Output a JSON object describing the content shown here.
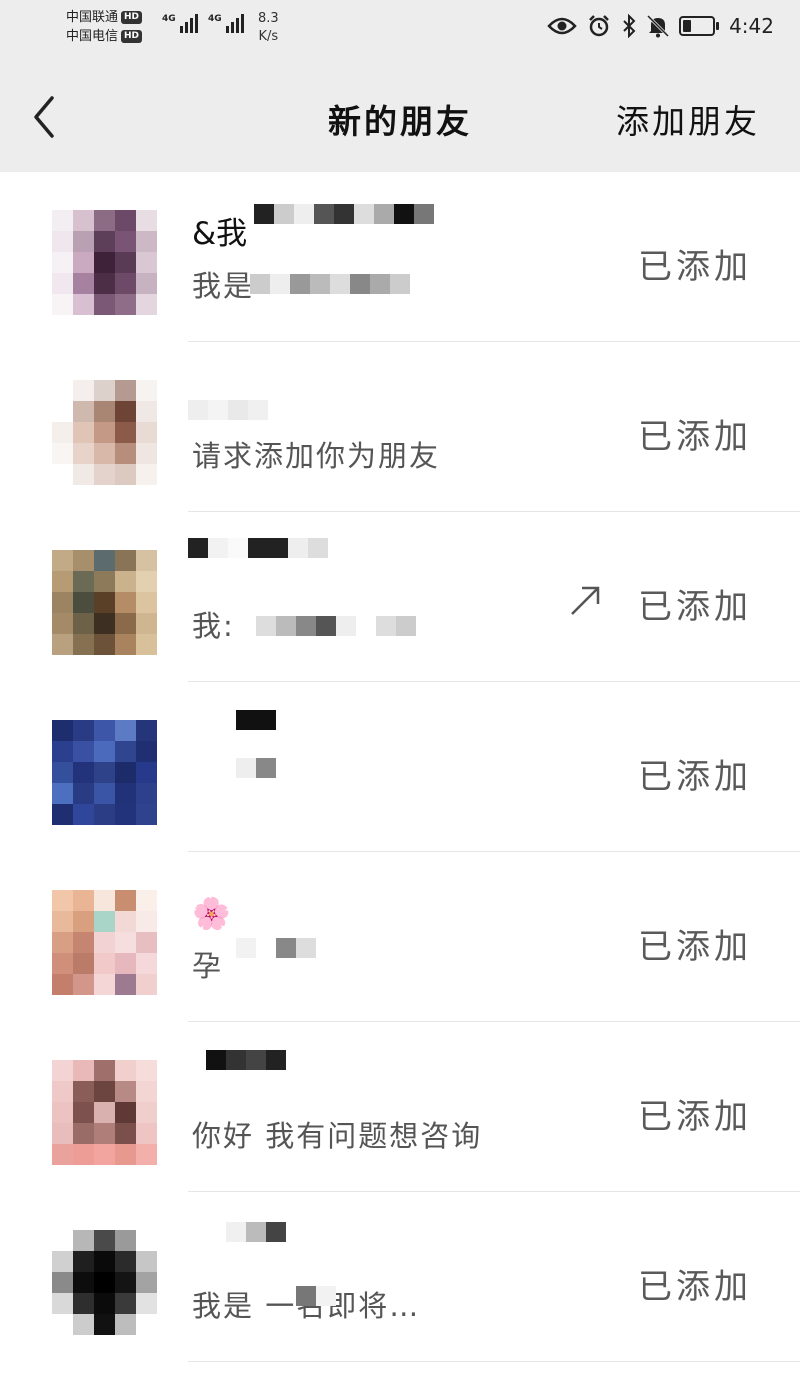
{
  "statusbar": {
    "carrier1": "中国联通",
    "carrier2": "中国电信",
    "hd": "HD",
    "network": "4G",
    "speed_value": "8.3",
    "speed_unit": "K/s",
    "battery_level": 0.3,
    "time": "4:42",
    "icons": [
      "eye-icon",
      "alarm-icon",
      "bluetooth-icon",
      "mute-icon",
      "battery-icon"
    ]
  },
  "navbar": {
    "back_icon": "chevron-left-icon",
    "title": "新的朋友",
    "action": "添加朋友"
  },
  "friends": [
    {
      "name": "&我",
      "msg": "我是",
      "status": "已添加",
      "avatar_colors": [
        "#f2eef2",
        "#d7c1cf",
        "#8c6b84",
        "#6c4a67",
        "#e9dde4",
        "#efe6ee",
        "#b9a0b3",
        "#5e3f5a",
        "#7a5474",
        "#cdb9c6",
        "#f6f1f4",
        "#c9aac0",
        "#3e2239",
        "#5a3b55",
        "#d9c7d3",
        "#f1e8ef",
        "#a681a0",
        "#4c2e47",
        "#6d4a67",
        "#c7b2c1",
        "#f8f4f6",
        "#d8bfd1",
        "#7b5876",
        "#8f6d88",
        "#e4d6df"
      ]
    },
    {
      "name": "",
      "msg": "请求添加你为朋友",
      "status": "已添加",
      "avatar_colors": [
        "#ffffff",
        "#f4eeec",
        "#ddd1cc",
        "#b49a90",
        "#f7f3f1",
        "#ffffff",
        "#cfb8ae",
        "#a88673",
        "#6e4436",
        "#efe8e4",
        "#f5efec",
        "#e0c5b7",
        "#c49a86",
        "#8c5a48",
        "#e8dbd4",
        "#f9f5f3",
        "#e7d3c9",
        "#d8b8a8",
        "#b78d7c",
        "#f0e6e1",
        "#ffffff",
        "#f1e9e5",
        "#e3d3cc",
        "#dcc9c0",
        "#f7f1ee"
      ]
    },
    {
      "name": "",
      "msg": "我:",
      "status": "已添加",
      "avatar_colors": [
        "#c2aa87",
        "#a78f6c",
        "#5c6b6e",
        "#8a7458",
        "#d6c2a3",
        "#b79b74",
        "#6a6a55",
        "#8d7a5a",
        "#c9b28c",
        "#e2d0b1",
        "#9c8463",
        "#4b4e3e",
        "#5a4027",
        "#b48d66",
        "#dcc4a0",
        "#a48a67",
        "#6d6148",
        "#3d2f22",
        "#8a6a48",
        "#cfb590",
        "#b9a17f",
        "#857052",
        "#6b5238",
        "#a8835d",
        "#d8c09b"
      ]
    },
    {
      "name": "",
      "msg": "",
      "status": "已添加",
      "avatar_colors": [
        "#1e2d6e",
        "#2a3b86",
        "#3d56a8",
        "#5d7bc4",
        "#24357a",
        "#2b3f8f",
        "#3950a3",
        "#4c6abb",
        "#2f4590",
        "#1f2f72",
        "#34509c",
        "#22337b",
        "#2d4289",
        "#1c2b69",
        "#27398a",
        "#4d6fc0",
        "#283b83",
        "#3a55a6",
        "#213278",
        "#2c408c",
        "#1f2e70",
        "#30469a",
        "#2a3d85",
        "#22337c",
        "#2e428d"
      ]
    },
    {
      "name": "🌸",
      "msg": "孕",
      "status": "已添加",
      "avatar_colors": [
        "#f2c6a8",
        "#e9b594",
        "#f7e6dc",
        "#c98d6f",
        "#fbefe9",
        "#e8b99a",
        "#d9a07f",
        "#a8d5c8",
        "#f3d9d6",
        "#f8eae6",
        "#d99f85",
        "#c58570",
        "#f2d2d2",
        "#f6dede",
        "#e7bfc3",
        "#cf8f7a",
        "#bb7b69",
        "#f0c9c8",
        "#e6b8bd",
        "#f5d8d9",
        "#c47e6c",
        "#d2978a",
        "#f4d6d6",
        "#9d7a8f",
        "#f2cfcf"
      ]
    },
    {
      "name": "",
      "msg": "你好  我有问题想咨询",
      "status": "已添加",
      "avatar_colors": [
        "#f3d3d3",
        "#e8b9b8",
        "#9e6f6b",
        "#f1cfcd",
        "#f6dddb",
        "#efc9c7",
        "#8a5d59",
        "#6c4541",
        "#b88a86",
        "#f3d6d4",
        "#ecc3c1",
        "#7d524e",
        "#d9b2b0",
        "#5e3935",
        "#f0cecc",
        "#e9bdbb",
        "#9a6c68",
        "#b07e79",
        "#7b4f4b",
        "#eec5c3",
        "#e9a39c",
        "#ee9d96",
        "#f1a59e",
        "#e79990",
        "#f3b0aa"
      ]
    },
    {
      "name": "",
      "msg": "我是       一名即将…",
      "status": "已添加",
      "avatar_colors": [
        "#ffffff",
        "#b7b7b7",
        "#4a4a4a",
        "#9a9a9a",
        "#ffffff",
        "#d0d0d0",
        "#1f1f1f",
        "#0a0a0a",
        "#2b2b2b",
        "#c6c6c6",
        "#8a8a8a",
        "#0d0d0d",
        "#000000",
        "#141414",
        "#a3a3a3",
        "#d9d9d9",
        "#2e2e2e",
        "#0b0b0b",
        "#3a3a3a",
        "#e2e2e2",
        "#ffffff",
        "#cccccc",
        "#111111",
        "#bdbdbd",
        "#ffffff"
      ]
    }
  ]
}
